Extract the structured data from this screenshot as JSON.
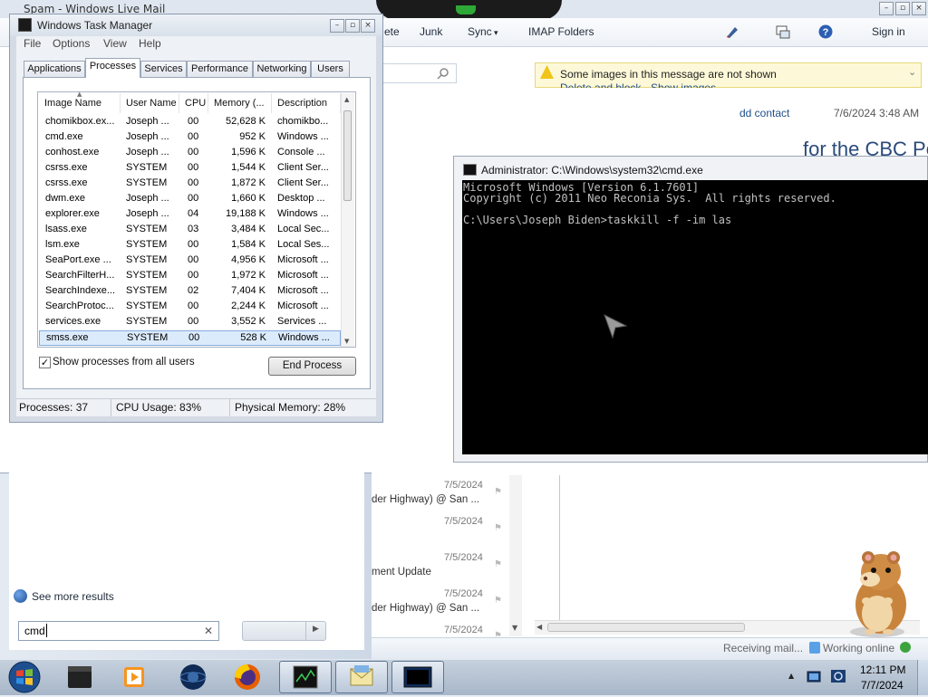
{
  "wlm": {
    "title": "Spam - Windows Live Mail",
    "toolbar": {
      "delete_label": "ete",
      "junk_label": "Junk",
      "sync_label": "Sync",
      "imap_label": "IMAP Folders",
      "signin_label": "Sign in"
    },
    "infobar": {
      "message": "Some images in this message are not shown",
      "links": "Delete and block · Show images"
    },
    "add_contact": "dd contact",
    "header_date": "7/6/2024 3:48 AM",
    "subject": "for the CBC Pol",
    "messages": [
      {
        "date": "7/5/2024",
        "snippet": "der Highway) @ San ..."
      },
      {
        "date": "7/5/2024",
        "snippet": ""
      },
      {
        "date": "7/5/2024",
        "snippet": "ment Update"
      },
      {
        "date": "7/5/2024",
        "snippet": "der Highway) @ San ..."
      },
      {
        "date": "7/5/2024",
        "snippet": ""
      }
    ],
    "status": {
      "receiving": "Receiving mail...",
      "online": "Working online"
    }
  },
  "task_manager": {
    "title": "Windows Task Manager",
    "menu": [
      "File",
      "Options",
      "View",
      "Help"
    ],
    "tabs": [
      "Applications",
      "Processes",
      "Services",
      "Performance",
      "Networking",
      "Users"
    ],
    "active_tab": "Processes",
    "columns": [
      "Image Name",
      "User Name",
      "CPU",
      "Memory (...",
      "Description"
    ],
    "rows": [
      {
        "name": "chomikbox.ex...",
        "user": "Joseph ...",
        "cpu": "00",
        "mem": "52,628 K",
        "desc": "chomikbo..."
      },
      {
        "name": "cmd.exe",
        "user": "Joseph ...",
        "cpu": "00",
        "mem": "952 K",
        "desc": "Windows ..."
      },
      {
        "name": "conhost.exe",
        "user": "Joseph ...",
        "cpu": "00",
        "mem": "1,596 K",
        "desc": "Console ..."
      },
      {
        "name": "csrss.exe",
        "user": "SYSTEM",
        "cpu": "00",
        "mem": "1,544 K",
        "desc": "Client Ser..."
      },
      {
        "name": "csrss.exe",
        "user": "SYSTEM",
        "cpu": "00",
        "mem": "1,872 K",
        "desc": "Client Ser..."
      },
      {
        "name": "dwm.exe",
        "user": "Joseph ...",
        "cpu": "00",
        "mem": "1,660 K",
        "desc": "Desktop ..."
      },
      {
        "name": "explorer.exe",
        "user": "Joseph ...",
        "cpu": "04",
        "mem": "19,188 K",
        "desc": "Windows ..."
      },
      {
        "name": "lsass.exe",
        "user": "SYSTEM",
        "cpu": "03",
        "mem": "3,484 K",
        "desc": "Local Sec..."
      },
      {
        "name": "lsm.exe",
        "user": "SYSTEM",
        "cpu": "00",
        "mem": "1,584 K",
        "desc": "Local Ses..."
      },
      {
        "name": "SeaPort.exe ...",
        "user": "SYSTEM",
        "cpu": "00",
        "mem": "4,956 K",
        "desc": "Microsoft ..."
      },
      {
        "name": "SearchFilterH...",
        "user": "SYSTEM",
        "cpu": "00",
        "mem": "1,972 K",
        "desc": "Microsoft ..."
      },
      {
        "name": "SearchIndexe...",
        "user": "SYSTEM",
        "cpu": "02",
        "mem": "7,404 K",
        "desc": "Microsoft ..."
      },
      {
        "name": "SearchProtoc...",
        "user": "SYSTEM",
        "cpu": "00",
        "mem": "2,244 K",
        "desc": "Microsoft ..."
      },
      {
        "name": "services.exe",
        "user": "SYSTEM",
        "cpu": "00",
        "mem": "3,552 K",
        "desc": "Services ..."
      },
      {
        "name": "smss.exe",
        "user": "SYSTEM",
        "cpu": "00",
        "mem": "528 K",
        "desc": "Windows ..."
      }
    ],
    "selected_row": "smss.exe",
    "show_all_label": "Show processes from all users",
    "show_all_checked": true,
    "end_process_label": "End Process",
    "status": {
      "processes": "Processes: 37",
      "cpu": "CPU Usage: 83%",
      "memory": "Physical Memory: 28%"
    }
  },
  "cmd": {
    "title": "Administrator: C:\\Windows\\system32\\cmd.exe",
    "lines": [
      "Microsoft Windows [Version 6.1.7601]",
      "Copyright (c) 2011 Neo Reconia Sys.  All rights reserved.",
      "",
      "C:\\Users\\Joseph Biden>taskkill -f -im las"
    ]
  },
  "start_menu": {
    "see_more": "See more results",
    "search_value": "cmd"
  },
  "taskbar": {
    "time": "12:11 PM",
    "date": "7/7/2024"
  },
  "colors": {
    "console_bg": "#000000",
    "console_fg": "#c0c0c0",
    "selection": "#dcebfc",
    "taskbar": "#b4c2d3"
  }
}
